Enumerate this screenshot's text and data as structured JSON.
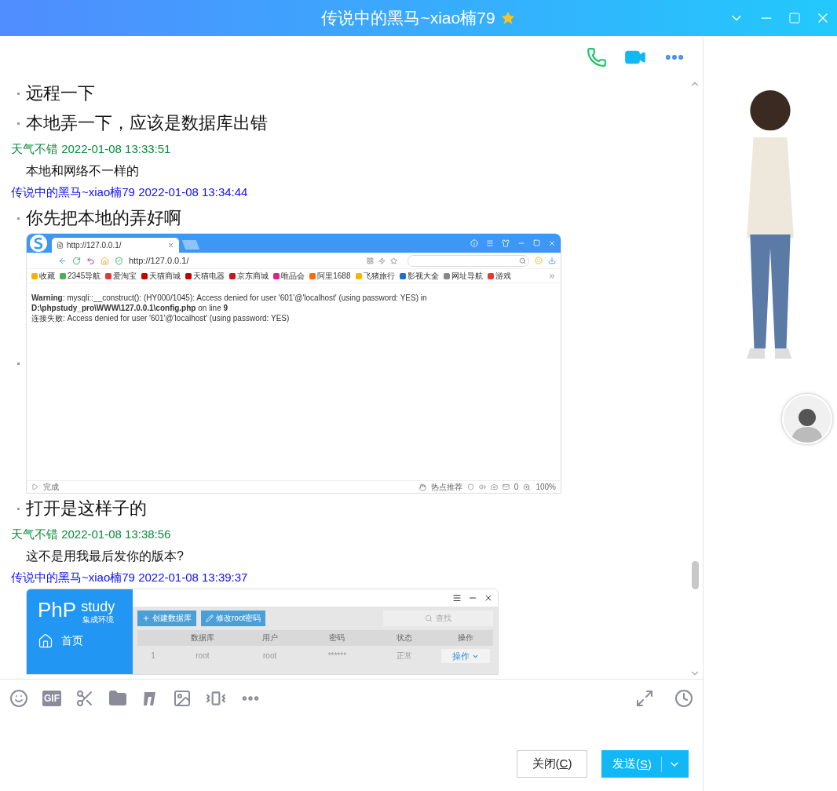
{
  "window": {
    "title": "传说中的黑马~xiao楠79"
  },
  "messages": [
    {
      "kind": "bullet",
      "text": "远程一下"
    },
    {
      "kind": "bullet",
      "text": "本地弄一下，应该是数据库出错"
    },
    {
      "kind": "header",
      "text": "天气不错 2022-01-08 13:33:51",
      "color": "#0a8a3a"
    },
    {
      "kind": "plain",
      "text": "本地和网络不一样的"
    },
    {
      "kind": "header",
      "text": "传说中的黑马~xiao楠79 2022-01-08 13:34:44",
      "color": "#1010f0"
    },
    {
      "kind": "bullet",
      "text": "你先把本地的弄好啊"
    },
    {
      "kind": "browser_shot",
      "tab_title": "http://127.0.0.1/",
      "url": "http://127.0.0.1/",
      "bookmarks": [
        {
          "label": "收藏",
          "color": "#f5b400"
        },
        {
          "label": "2345导航",
          "color": "#4caf50"
        },
        {
          "label": "爱淘宝",
          "color": "#e4393c"
        },
        {
          "label": "天猫商城",
          "color": "#c40000"
        },
        {
          "label": "天猫电器",
          "color": "#c40000"
        },
        {
          "label": "京东商城",
          "color": "#c91623"
        },
        {
          "label": "唯品会",
          "color": "#e0218a"
        },
        {
          "label": "阿里1688",
          "color": "#ff6a00"
        },
        {
          "label": "飞猪旅行",
          "color": "#f5b400"
        },
        {
          "label": "影视大全",
          "color": "#1f6fc5"
        },
        {
          "label": "网址导航",
          "color": "#888888"
        },
        {
          "label": "游戏",
          "color": "#e53935"
        }
      ],
      "warning": "**Warning**: mysqli::__construct(): (HY000/1045): Access denied for user '601'@'localhost' (using password: YES) in **D:\\phpstudy_pro\\WWW\\127.0.0.1\\config.php** on line **9**",
      "error": "连接失败: Access denied for user '601'@'localhost' (using password: YES)",
      "status": "完成",
      "hot": "热点推荐",
      "count": "0",
      "zoom": "100%"
    },
    {
      "kind": "bullet",
      "text": "打开是这样子的"
    },
    {
      "kind": "header",
      "text": "天气不错 2022-01-08 13:38:56",
      "color": "#0a8a3a"
    },
    {
      "kind": "plain",
      "text": "这不是用我最后发你的版本?"
    },
    {
      "kind": "header",
      "text": "传说中的黑马~xiao楠79 2022-01-08 13:39:37",
      "color": "#1010f0"
    },
    {
      "kind": "phpstudy_shot",
      "logo_main": "PhP",
      "logo_sub": "study",
      "logo_tag": "集成环境",
      "nav": "首页",
      "buttons": [
        "创建数据库",
        "修改root密码"
      ],
      "search_placeholder": "查找",
      "columns": [
        "数据库",
        "用户",
        "密码",
        "状态",
        "操作"
      ],
      "row": {
        "cells": [
          "1",
          "root",
          "root",
          "******",
          "正常"
        ],
        "action": "操作"
      }
    }
  ],
  "toolbar": {
    "gif_label": "GIF"
  },
  "buttons": {
    "close": {
      "before": "关闭(",
      "hotkey": "C",
      "after": ")"
    },
    "send": {
      "before": "发送(",
      "hotkey": "S",
      "after": ")"
    }
  }
}
